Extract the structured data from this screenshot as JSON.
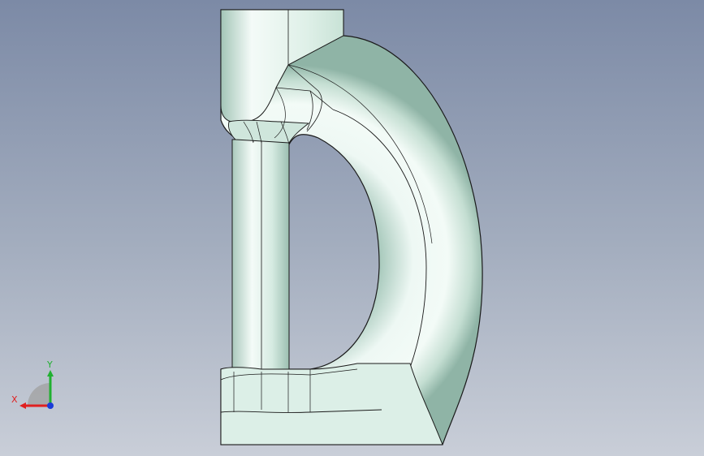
{
  "viewport": {
    "background_top": "#7c8aa6",
    "background_bottom": "#c9ced8"
  },
  "part": {
    "fill_color": "#e6f4ee",
    "edge_color": "#1a1a1a",
    "shade_color": "#9dbfb2"
  },
  "triad": {
    "x_label": "X",
    "y_label": "Y",
    "x_color": "#e02020",
    "y_color": "#20b030",
    "z_color": "#1a3cd8"
  }
}
